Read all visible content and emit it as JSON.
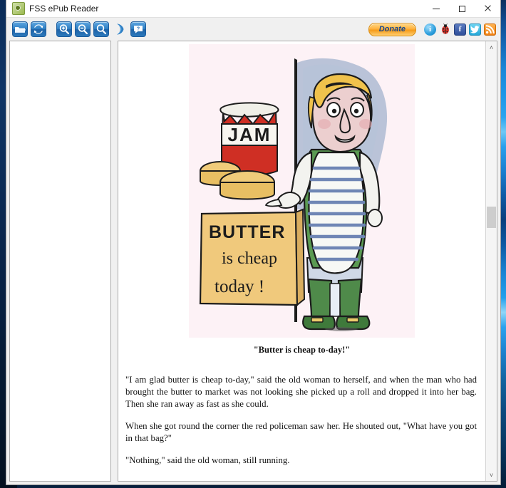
{
  "window": {
    "title": "FSS ePub Reader",
    "app_icon": "app-leaf-icon",
    "controls": {
      "minimize": "minimize-icon",
      "maximize": "maximize-icon",
      "close": "close-icon"
    }
  },
  "toolbar": {
    "left_buttons": [
      {
        "name": "open-file-button",
        "icon": "folder-open-icon",
        "tooltip": "Open"
      },
      {
        "name": "reload-button",
        "icon": "refresh-arrows-icon",
        "tooltip": "Reload"
      },
      {
        "name": "zoom-in-button",
        "icon": "magnifier-plus-icon",
        "tooltip": "Zoom In"
      },
      {
        "name": "zoom-out-button",
        "icon": "magnifier-minus-icon",
        "tooltip": "Zoom Out"
      },
      {
        "name": "zoom-reset-button",
        "icon": "magnifier-icon",
        "tooltip": "Zoom"
      },
      {
        "name": "rotate-button",
        "icon": "crescent-arc-icon",
        "tooltip": "Rotate"
      },
      {
        "name": "comment-button",
        "icon": "speech-bubble-icon",
        "tooltip": "Comment"
      }
    ],
    "donate_label": "Donate",
    "right_icons": [
      {
        "name": "info-button",
        "icon": "info-circle-icon",
        "glyph": "i"
      },
      {
        "name": "report-bug-button",
        "icon": "ladybug-icon",
        "glyph": ""
      },
      {
        "name": "facebook-button",
        "icon": "facebook-icon",
        "glyph": "f"
      },
      {
        "name": "twitter-button",
        "icon": "twitter-bird-icon",
        "glyph": ""
      },
      {
        "name": "rss-button",
        "icon": "rss-feed-icon",
        "glyph": ""
      }
    ]
  },
  "toc": {
    "items": []
  },
  "book": {
    "illustration": {
      "alt": "Cartoon butter seller standing beside a butter stall",
      "background_color": "#fdf2f6",
      "sign_lines": [
        "BUTTER",
        "is cheap",
        "today !"
      ],
      "jar_label": "JAM"
    },
    "caption": "\"Butter is cheap to-day!\"",
    "paragraphs": [
      "\"I am glad butter is cheap to-day,\" said the old woman to herself, and when the man who had brought the butter to market was not looking she picked up a roll and dropped it into her bag. Then she ran away as fast as she could.",
      "When she got round the corner the red policeman saw her. He shouted out, \"What have you got in that bag?\"",
      "\"Nothing,\" said the old woman, still running."
    ]
  },
  "scrollbar": {
    "up_arrow": "˄",
    "down_arrow": "˅"
  },
  "colors": {
    "accent_blue": "#2f7fc4",
    "donate_orange": "#ffb23d",
    "donate_text": "#17488f",
    "desktop_navy": "#08203e",
    "panel_white": "#ffffff"
  }
}
